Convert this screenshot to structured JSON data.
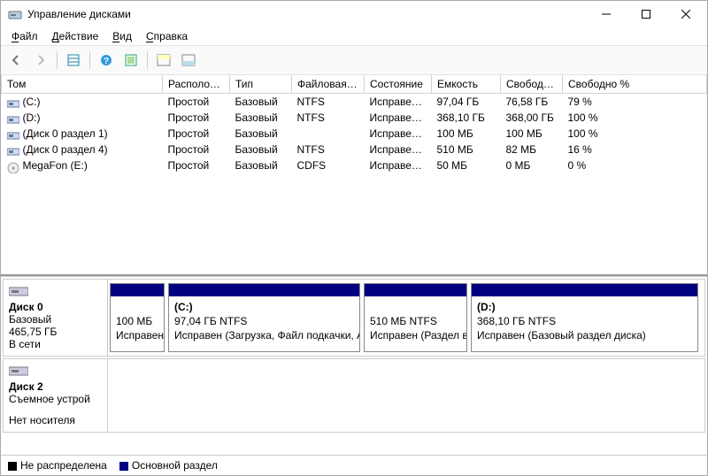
{
  "window": {
    "title": "Управление дисками"
  },
  "menu": {
    "file": "Файл",
    "action": "Действие",
    "view": "Вид",
    "help": "Справка"
  },
  "columns": {
    "tom": "Том",
    "layout": "Располож…",
    "type": "Тип",
    "fs": "Файловая с…",
    "status": "Состояние",
    "capacity": "Емкость",
    "free": "Свобод…",
    "freepct": "Свободно %"
  },
  "volumes": [
    {
      "icon": "vol",
      "name": "(C:)",
      "layout": "Простой",
      "type": "Базовый",
      "fs": "NTFS",
      "status": "Исправен…",
      "cap": "97,04 ГБ",
      "free": "76,58 ГБ",
      "pct": "79 %"
    },
    {
      "icon": "vol",
      "name": "(D:)",
      "layout": "Простой",
      "type": "Базовый",
      "fs": "NTFS",
      "status": "Исправен…",
      "cap": "368,10 ГБ",
      "free": "368,00 ГБ",
      "pct": "100 %"
    },
    {
      "icon": "vol",
      "name": "(Диск 0 раздел 1)",
      "layout": "Простой",
      "type": "Базовый",
      "fs": "",
      "status": "Исправен…",
      "cap": "100 МБ",
      "free": "100 МБ",
      "pct": "100 %"
    },
    {
      "icon": "vol",
      "name": "(Диск 0 раздел 4)",
      "layout": "Простой",
      "type": "Базовый",
      "fs": "NTFS",
      "status": "Исправен…",
      "cap": "510 МБ",
      "free": "82 МБ",
      "pct": "16 %"
    },
    {
      "icon": "cd",
      "name": "MegaFon (E:)",
      "layout": "Простой",
      "type": "Базовый",
      "fs": "CDFS",
      "status": "Исправен…",
      "cap": "50 МБ",
      "free": "0 МБ",
      "pct": "0 %"
    }
  ],
  "disks": [
    {
      "name": "Диск 0",
      "type": "Базовый",
      "size": "465,75 ГБ",
      "status": "В сети",
      "parts": [
        {
          "flex": 60,
          "title": "",
          "info": "100 МБ",
          "status": "Исправен (Ш"
        },
        {
          "flex": 215,
          "title": "(C:)",
          "info": "97,04 ГБ NTFS",
          "status": "Исправен (Загрузка, Файл подкачки, А"
        },
        {
          "flex": 115,
          "title": "",
          "info": "510 МБ NTFS",
          "status": "Исправен (Раздел в"
        },
        {
          "flex": 255,
          "title": "(D:)",
          "info": "368,10 ГБ NTFS",
          "status": "Исправен (Базовый раздел диска)"
        }
      ]
    },
    {
      "name": "Диск 2",
      "type": "Съемное устрой",
      "size": "",
      "status": "Нет носителя",
      "parts": []
    }
  ],
  "legend": {
    "unalloc": "Не распределена",
    "primary": "Основной раздел"
  },
  "colors": {
    "primary": "#000080",
    "unalloc": "#000000"
  }
}
